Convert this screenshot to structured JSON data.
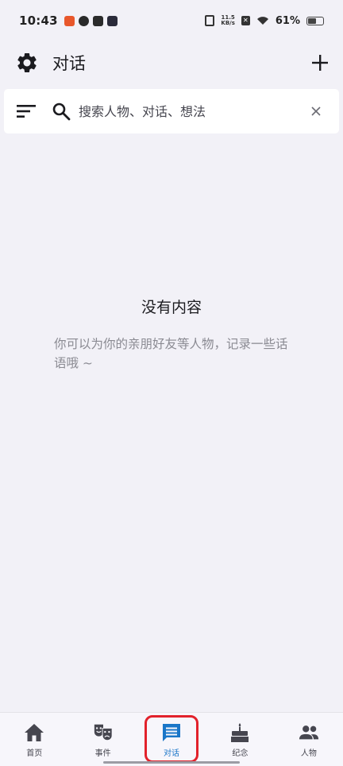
{
  "status_bar": {
    "time": "10:43",
    "net_speed_value": "11.5",
    "net_speed_unit": "KB/s",
    "battery_pct": "61%",
    "battery_level": 0.61
  },
  "header": {
    "title": "对话",
    "settings_icon": "gear-icon",
    "add_icon": "plus-icon"
  },
  "search": {
    "placeholder": "搜索人物、对话、想法"
  },
  "empty_state": {
    "title": "没有内容",
    "description": "你可以为你的亲朋好友等人物，记录一些话语哦 ~"
  },
  "nav": {
    "items": [
      {
        "label": "首页",
        "icon": "home-icon"
      },
      {
        "label": "事件",
        "icon": "theater-masks-icon"
      },
      {
        "label": "对话",
        "icon": "chat-icon",
        "active": true
      },
      {
        "label": "纪念",
        "icon": "cake-icon"
      },
      {
        "label": "人物",
        "icon": "people-icon"
      }
    ]
  },
  "colors": {
    "background": "#f2f1f7",
    "accent": "#1a76c8",
    "highlight_border": "#e2212b"
  }
}
